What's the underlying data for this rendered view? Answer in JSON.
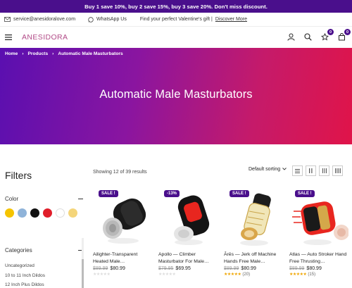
{
  "promo": "Buy 1 save 10%, buy 2 save 15%, buy 3 save 20%. Don't miss discount.",
  "topbar": {
    "email": "service@anesidoralove.com",
    "whatsapp": "WhatsApp Us",
    "gift_text": "Find your perfect Valentine's gift |",
    "gift_link": "Discover More"
  },
  "header": {
    "logo": "ANESIDORA",
    "wishlist_count": "0",
    "cart_count": "0"
  },
  "breadcrumb": [
    "Home",
    "Products",
    "Automatic Male Masturbators"
  ],
  "hero_title": "Automatic Male Masturbators",
  "filters": {
    "title": "Filters",
    "color_label": "Color",
    "colors": [
      "#f5c400",
      "#8fb3d9",
      "#111111",
      "#e01e2a",
      "#ffffff",
      "#f4d57a"
    ],
    "categories_label": "Categories",
    "categories": [
      "Uncategorized",
      "10 to 11 Inch Dildos",
      "12 Inch Plus Dildos"
    ]
  },
  "toolbar": {
    "results": "Showing 12 of 39 results",
    "sort": "Default sorting"
  },
  "products": [
    {
      "tag": "SALE !",
      "name": "Ailighter-Transparent Heated Male…",
      "old_price": "$89.99",
      "price": "$80.99",
      "rating_count": ""
    },
    {
      "tag": "-13%",
      "name": "Apollo — Climber Masturbator For Male…",
      "old_price": "$79.95",
      "price": "$69.95",
      "rating_count": ""
    },
    {
      "tag": "SALE !",
      "name": "Ārēs — Jerk off Machine Hands Free Male…",
      "old_price": "$89.99",
      "price": "$80.99",
      "rating_count": "(20)"
    },
    {
      "tag": "SALE !",
      "name": "Atlas — Auto Stroker Hand Free Thrusting…",
      "old_price": "$89.99",
      "price": "$80.99",
      "rating_count": "(15)"
    }
  ]
}
